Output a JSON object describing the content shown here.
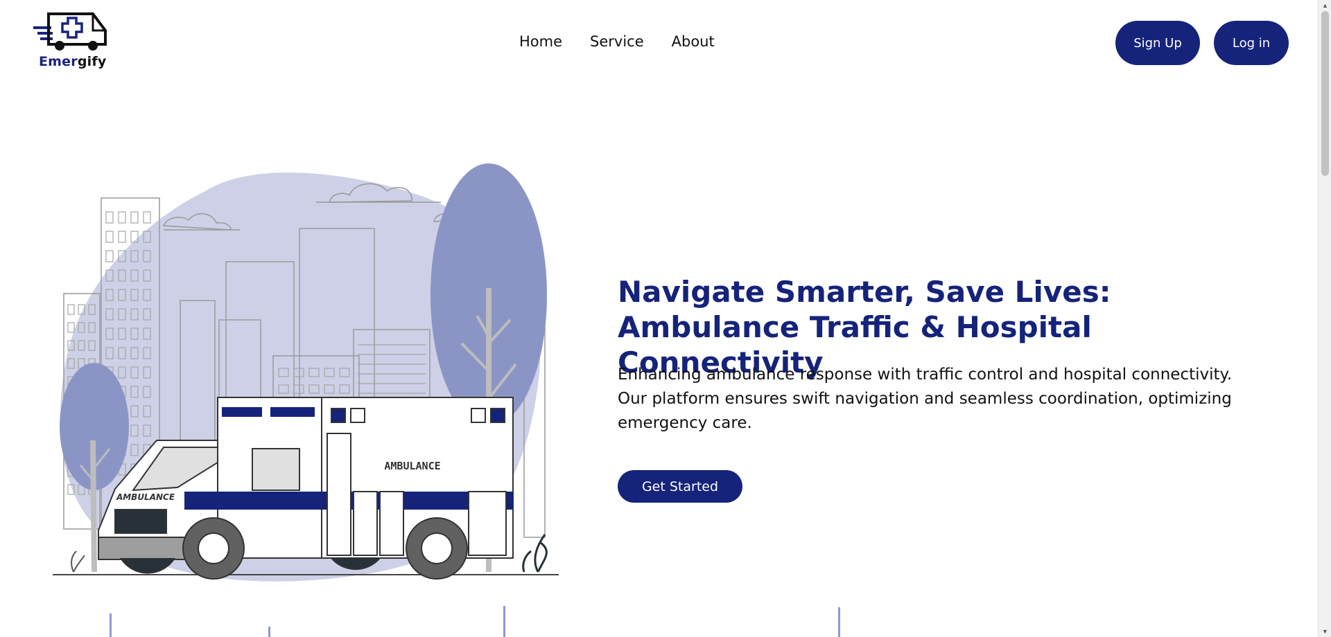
{
  "brand": {
    "name_part1": "Emer",
    "name_part2": "gify",
    "color_primary": "#15237a"
  },
  "nav": {
    "items": [
      "Home",
      "Service",
      "About"
    ]
  },
  "auth": {
    "signup_label": "Sign Up",
    "login_label": "Log in"
  },
  "hero": {
    "title": "Navigate Smarter, Save Lives: Ambulance Traffic & Hospital Connectivity",
    "description": "Enhancing ambulance response with traffic control and hospital connectivity. Our platform ensures swift navigation and seamless coordination, optimizing emergency care.",
    "cta_label": "Get Started",
    "illustration": {
      "icon": "ambulance-city-illustration",
      "vehicle_label": "AMBULANCE"
    }
  },
  "icons": {
    "logo": "ambulance-logo-icon",
    "scroll_up": "chevron-up-icon",
    "scroll_down": "chevron-down-icon"
  },
  "colors": {
    "accent": "#15237a",
    "blob": "#cdd0e6",
    "tree": "#8b95c5"
  }
}
